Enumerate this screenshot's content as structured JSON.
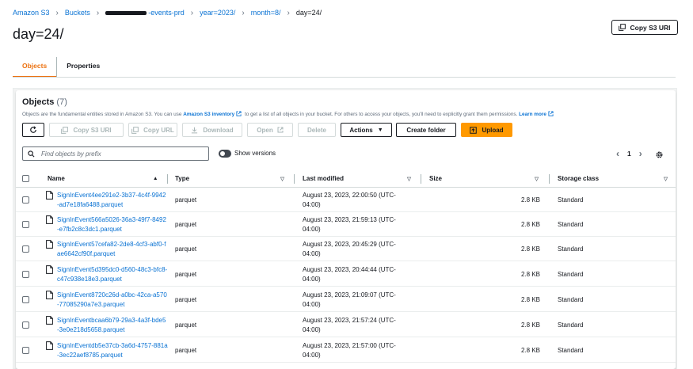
{
  "breadcrumb": {
    "s3": "Amazon S3",
    "buckets": "Buckets",
    "bucket_suffix": "-events-prd",
    "year": "year=2023/",
    "month": "month=8/",
    "day": "day=24/"
  },
  "page": {
    "title": "day=24/",
    "copy_s3_uri": "Copy S3 URI"
  },
  "tabs": [
    {
      "label": "Objects",
      "active": true
    },
    {
      "label": "Properties",
      "active": false
    }
  ],
  "objects": {
    "title": "Objects",
    "count": "(7)",
    "description": {
      "pre": "Objects are the fundamental entities stored in Amazon S3. You can use ",
      "inventory_link": "Amazon S3 inventory",
      "mid": " to get a list of all objects in your bucket. For others to access your objects, you'll need to explicitly grant them permissions. ",
      "learn_more": "Learn more"
    },
    "actions": {
      "copy_s3_uri": "Copy S3 URI",
      "copy_url": "Copy URL",
      "download": "Download",
      "open": "Open",
      "delete": "Delete",
      "actions": "Actions",
      "create_folder": "Create folder",
      "upload": "Upload"
    },
    "search_placeholder": "Find objects by prefix",
    "show_versions": "Show versions",
    "page_number": "1",
    "columns": {
      "name": "Name",
      "type": "Type",
      "last_modified": "Last modified",
      "size": "Size",
      "storage_class": "Storage class"
    },
    "rows": [
      {
        "name": "SignInEvent4ee291e2-3b37-4c4f-9942-ad7e18fa6488.parquet",
        "type": "parquet",
        "modified": "August 23, 2023, 22:00:50 (UTC-04:00)",
        "size": "2.8 KB",
        "class": "Standard"
      },
      {
        "name": "SignInEvent566a5026-36a3-49f7-8492-e7fb2c8c3dc1.parquet",
        "type": "parquet",
        "modified": "August 23, 2023, 21:59:13 (UTC-04:00)",
        "size": "2.8 KB",
        "class": "Standard"
      },
      {
        "name": "SignInEvent57cefa82-2de8-4cf3-abf0-fae6642cf90f.parquet",
        "type": "parquet",
        "modified": "August 23, 2023, 20:45:29 (UTC-04:00)",
        "size": "2.8 KB",
        "class": "Standard"
      },
      {
        "name": "SignInEvent5d395dc0-d560-48c3-bfc8-c47c938e18e3.parquet",
        "type": "parquet",
        "modified": "August 23, 2023, 20:44:44 (UTC-04:00)",
        "size": "2.8 KB",
        "class": "Standard"
      },
      {
        "name": "SignInEvent8720c26d-a0bc-42ca-a570-77085290a7e3.parquet",
        "type": "parquet",
        "modified": "August 23, 2023, 21:09:07 (UTC-04:00)",
        "size": "2.8 KB",
        "class": "Standard"
      },
      {
        "name": "SignInEventbcaa6b79-29a3-4a3f-bde5-3e0e218d5658.parquet",
        "type": "parquet",
        "modified": "August 23, 2023, 21:57:24 (UTC-04:00)",
        "size": "2.8 KB",
        "class": "Standard"
      },
      {
        "name": "SignInEventdb5e37cb-3a6d-4757-881a-3ec22aef8785.parquet",
        "type": "parquet",
        "modified": "August 23, 2023, 21:57:00 (UTC-04:00)",
        "size": "2.8 KB",
        "class": "Standard"
      }
    ]
  },
  "colors": {
    "link": "#0972d3",
    "accent": "#ec7211",
    "primary_button": "#ff9900"
  }
}
